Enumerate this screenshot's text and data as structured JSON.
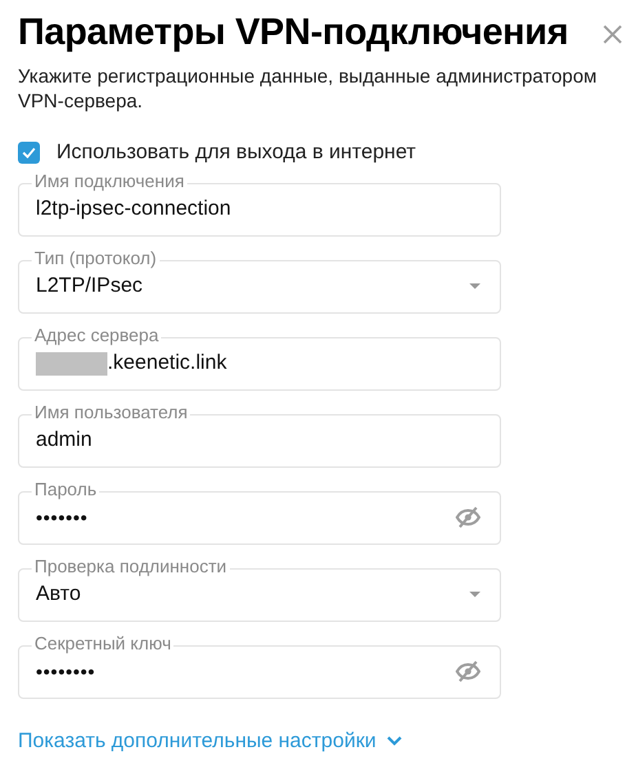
{
  "dialog": {
    "title": "Параметры VPN-подключения",
    "description": "Укажите регистрационные данные, выданные администратором VPN-сервера."
  },
  "checkbox": {
    "label": "Использовать для выхода в интернет",
    "checked": true
  },
  "fields": [
    {
      "kind": "text",
      "label": "Имя подключения",
      "value": "l2tp-ipsec-connection"
    },
    {
      "kind": "select",
      "label": "Тип (протокол)",
      "value": "L2TP/IPsec"
    },
    {
      "kind": "text",
      "label": "Адрес сервера",
      "value": ".keenetic.link",
      "redacted": true
    },
    {
      "kind": "text",
      "label": "Имя пользователя",
      "value": "admin"
    },
    {
      "kind": "password",
      "label": "Пароль",
      "value": "•••••••"
    },
    {
      "kind": "select",
      "label": "Проверка подлинности",
      "value": "Авто"
    },
    {
      "kind": "password",
      "label": "Секретный ключ",
      "value": "••••••••"
    }
  ],
  "more_link": "Показать дополнительные настройки"
}
